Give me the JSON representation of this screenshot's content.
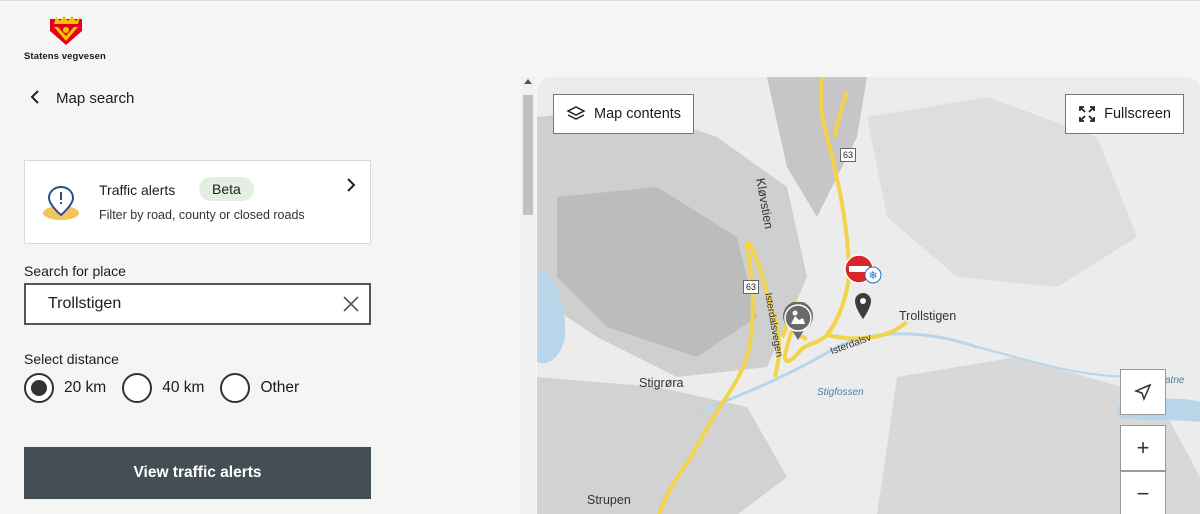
{
  "brand": {
    "name": "Statens vegvesen"
  },
  "nav": {
    "back_label": "Map search"
  },
  "traffic_alerts_card": {
    "title": "Traffic alerts",
    "badge": "Beta",
    "subtitle": "Filter by road, county or closed roads"
  },
  "search": {
    "label": "Search for place",
    "value": "Trollstigen"
  },
  "distance": {
    "label": "Select distance",
    "options": [
      {
        "label": "20 km",
        "selected": true
      },
      {
        "label": "40 km",
        "selected": false
      },
      {
        "label": "Other",
        "selected": false
      }
    ]
  },
  "action": {
    "view_label": "View traffic alerts"
  },
  "map": {
    "contents_label": "Map contents",
    "fullscreen_label": "Fullscreen",
    "zoom_in": "+",
    "zoom_out": "−",
    "places": [
      "Trollstigen",
      "Stigrøra",
      "Strupen",
      "Kløvstien",
      "Stigfossen"
    ],
    "roads": [
      "Isterdalsvegen",
      "Isterdalsv",
      "63",
      "63",
      "atne"
    ],
    "colors": {
      "road": "#f2d34a",
      "closure": "#d9262b",
      "marker": "#4a4a4a",
      "water": "#b8d5ea"
    }
  }
}
